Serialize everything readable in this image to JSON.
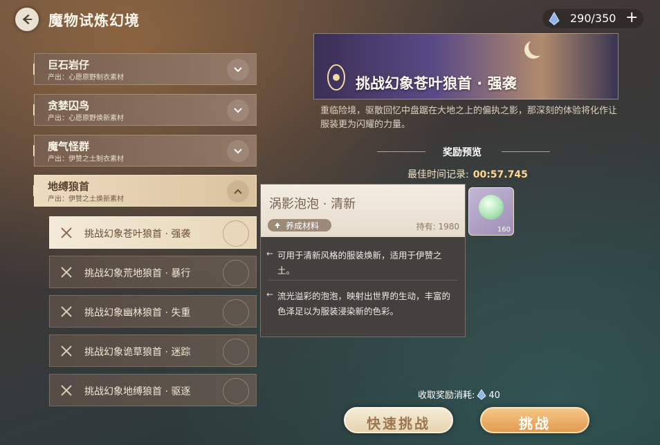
{
  "header": {
    "title": "魔物试炼幻境",
    "stamina": "290/350",
    "plus": "+"
  },
  "categories": [
    {
      "name": "巨石岩仔",
      "sub": "产出：心愿原野制衣素材"
    },
    {
      "name": "贪婪囚鸟",
      "sub": "产出：心愿原野焕新素材"
    },
    {
      "name": "魔气怪群",
      "sub": "产出：伊赞之土制衣素材"
    },
    {
      "name": "地缚狼首",
      "sub": "产出：伊赞之土焕新素材"
    }
  ],
  "stages": [
    "挑战幻象苍叶狼首 · 强袭",
    "挑战幻象荒地狼首 · 暴行",
    "挑战幻象幽林狼首 · 失重",
    "挑战幻象诡草狼首 · 迷踪",
    "挑战幻象地缚狼首 · 驱逐"
  ],
  "detail": {
    "banner_title": "挑战幻象苍叶狼首 · 强袭",
    "description": "重临险境，驱散回忆中盘踞在大地之上的偏执之影，那深刻的体验将化作让服装更为闪耀的力量。",
    "reward_header": "奖励预览",
    "best_time_label": "最佳时间记录:",
    "best_time_value": "00:57.745",
    "reward_qty": "160",
    "cost_label": "收取奖励消耗:",
    "cost_value": "40",
    "quick_button": "快速挑战",
    "challenge_button": "挑战"
  },
  "tooltip": {
    "name": "涡影泡泡 · 清新",
    "tag": "养成材料",
    "owned": "持有: 1980",
    "line1": "可用于清新风格的服装焕新，适用于伊赞之土。",
    "line2": "流光溢彩的泡泡，映射出世界的生动，丰富的色泽足以为服装浸染新的色彩。"
  }
}
